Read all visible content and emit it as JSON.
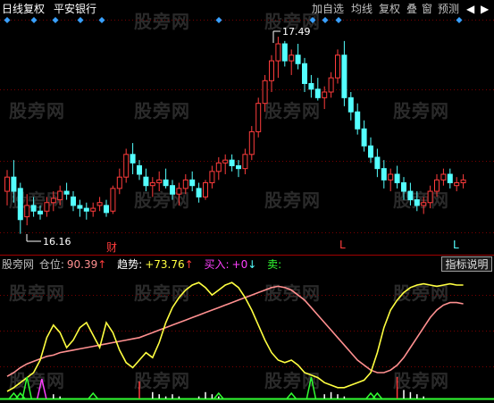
{
  "header": {
    "period": "日线",
    "adjust": "复权",
    "security_name": "平安银行"
  },
  "toolbar": [
    {
      "label": "加自选",
      "name": "add-watchlist-button"
    },
    {
      "label": "均线",
      "name": "moving-average-button"
    },
    {
      "label": "复权",
      "name": "adjust-button"
    },
    {
      "label": "叠",
      "name": "overlay-button"
    },
    {
      "label": "窗",
      "name": "window-button"
    },
    {
      "label": "预测",
      "name": "forecast-button"
    },
    {
      "label": "◀",
      "name": "scroll-left-button"
    },
    {
      "label": "▶",
      "name": "scroll-right-button"
    }
  ],
  "watermark": "股旁网",
  "annotations": {
    "high": "17.49",
    "low": "16.16",
    "cai": "财",
    "l1": "L",
    "l2": "L"
  },
  "indicator": {
    "name": "股旁网",
    "pos_label": "仓位:",
    "pos_value": "90.39",
    "trend_label": "趋势:",
    "trend_value": "+73.76",
    "buy_label": "买入:",
    "buy_value": "+0",
    "sell_label": "卖:",
    "explain_button": "指标说明"
  },
  "colors": {
    "up": "#ff3c3c",
    "down": "#54ffff",
    "pink_line": "#ff9090",
    "yellow_line": "#ffff40",
    "magenta": "#ff40ff",
    "green": "#32ff32",
    "blue_marker": "#39a0ff",
    "grid": "#7a0000"
  },
  "chart_data": [
    {
      "type": "candlestick",
      "series": [
        {
          "name": "平安银行"
        }
      ],
      "markers": {
        "high": 17.49,
        "low": 16.16
      },
      "candles": [
        [
          16.4,
          16.55,
          16.3,
          16.5
        ],
        [
          16.5,
          16.62,
          16.32,
          16.4
        ],
        [
          16.42,
          16.46,
          16.1,
          16.2
        ],
        [
          16.22,
          16.38,
          16.16,
          16.3
        ],
        [
          16.3,
          16.36,
          16.22,
          16.26
        ],
        [
          16.26,
          16.3,
          16.2,
          16.24
        ],
        [
          16.26,
          16.36,
          16.22,
          16.32
        ],
        [
          16.32,
          16.4,
          16.26,
          16.35
        ],
        [
          16.34,
          16.44,
          16.3,
          16.4
        ],
        [
          16.4,
          16.46,
          16.34,
          16.38
        ],
        [
          16.36,
          16.4,
          16.26,
          16.3
        ],
        [
          16.3,
          16.34,
          16.22,
          16.28
        ],
        [
          16.28,
          16.32,
          16.2,
          16.26
        ],
        [
          16.26,
          16.32,
          16.22,
          16.28
        ],
        [
          16.3,
          16.36,
          16.26,
          16.32
        ],
        [
          16.3,
          16.34,
          16.22,
          16.25
        ],
        [
          16.26,
          16.44,
          16.24,
          16.42
        ],
        [
          16.42,
          16.56,
          16.38,
          16.5
        ],
        [
          16.5,
          16.7,
          16.46,
          16.66
        ],
        [
          16.66,
          16.74,
          16.52,
          16.6
        ],
        [
          16.58,
          16.62,
          16.48,
          16.52
        ],
        [
          16.5,
          16.56,
          16.4,
          16.44
        ],
        [
          16.44,
          16.5,
          16.36,
          16.46
        ],
        [
          16.46,
          16.54,
          16.4,
          16.48
        ],
        [
          16.48,
          16.56,
          16.42,
          16.44
        ],
        [
          16.44,
          16.48,
          16.34,
          16.38
        ],
        [
          16.38,
          16.46,
          16.3,
          16.42
        ],
        [
          16.42,
          16.52,
          16.38,
          16.48
        ],
        [
          16.48,
          16.54,
          16.4,
          16.44
        ],
        [
          16.42,
          16.46,
          16.32,
          16.36
        ],
        [
          16.36,
          16.48,
          16.34,
          16.46
        ],
        [
          16.46,
          16.58,
          16.42,
          16.54
        ],
        [
          16.54,
          16.64,
          16.48,
          16.6
        ],
        [
          16.6,
          16.66,
          16.52,
          16.62
        ],
        [
          16.62,
          16.66,
          16.54,
          16.58
        ],
        [
          16.58,
          16.62,
          16.5,
          16.56
        ],
        [
          16.56,
          16.7,
          16.52,
          16.66
        ],
        [
          16.66,
          16.86,
          16.62,
          16.82
        ],
        [
          16.82,
          17.06,
          16.78,
          17.02
        ],
        [
          17.02,
          17.22,
          16.96,
          17.18
        ],
        [
          17.18,
          17.36,
          17.1,
          17.32
        ],
        [
          17.32,
          17.49,
          17.2,
          17.44
        ],
        [
          17.44,
          17.46,
          17.28,
          17.32
        ],
        [
          17.32,
          17.4,
          17.22,
          17.36
        ],
        [
          17.36,
          17.44,
          17.26,
          17.3
        ],
        [
          17.3,
          17.34,
          17.1,
          17.16
        ],
        [
          17.16,
          17.22,
          17.06,
          17.12
        ],
        [
          17.12,
          17.2,
          17.04,
          17.06
        ],
        [
          17.06,
          17.14,
          16.98,
          17.1
        ],
        [
          17.1,
          17.24,
          17.06,
          17.2
        ],
        [
          17.2,
          17.4,
          17.16,
          17.36
        ],
        [
          17.36,
          17.46,
          17.0,
          17.06
        ],
        [
          17.06,
          17.1,
          16.9,
          16.96
        ],
        [
          16.96,
          17.02,
          16.8,
          16.84
        ],
        [
          16.84,
          16.9,
          16.68,
          16.72
        ],
        [
          16.72,
          16.78,
          16.6,
          16.64
        ],
        [
          16.64,
          16.7,
          16.5,
          16.56
        ],
        [
          16.56,
          16.62,
          16.42,
          16.48
        ],
        [
          16.48,
          16.56,
          16.4,
          16.52
        ],
        [
          16.52,
          16.58,
          16.42,
          16.46
        ],
        [
          16.46,
          16.5,
          16.34,
          16.4
        ],
        [
          16.4,
          16.46,
          16.3,
          16.34
        ],
        [
          16.34,
          16.4,
          16.26,
          16.3
        ],
        [
          16.3,
          16.36,
          16.24,
          16.32
        ],
        [
          16.32,
          16.44,
          16.28,
          16.4
        ],
        [
          16.4,
          16.52,
          16.36,
          16.48
        ],
        [
          16.48,
          16.56,
          16.44,
          16.52
        ],
        [
          16.52,
          16.56,
          16.42,
          16.46
        ],
        [
          16.44,
          16.5,
          16.4,
          16.46
        ],
        [
          16.46,
          16.52,
          16.42,
          16.48
        ]
      ]
    },
    {
      "type": "line",
      "series": [
        {
          "name": "趋势",
          "values": [
            17,
            20,
            24,
            27,
            29,
            31,
            33,
            34,
            36,
            37,
            38,
            39,
            40,
            41,
            42,
            43,
            44,
            45,
            46,
            47,
            48,
            50,
            52,
            54,
            56,
            58,
            60,
            62,
            64,
            66,
            68,
            70,
            72,
            74,
            76,
            78,
            80,
            82,
            84,
            86,
            88,
            89,
            88,
            86,
            82,
            78,
            72,
            66,
            60,
            54,
            48,
            42,
            36,
            30,
            26,
            22,
            20,
            20,
            22,
            26,
            32,
            40,
            48,
            56,
            64,
            70,
            74,
            76,
            76,
            75
          ]
        },
        {
          "name": "仓位",
          "values": [
            5,
            8,
            12,
            16,
            20,
            30,
            48,
            58,
            52,
            40,
            46,
            56,
            60,
            50,
            40,
            60,
            52,
            38,
            28,
            24,
            30,
            36,
            32,
            44,
            60,
            72,
            80,
            86,
            90,
            92,
            88,
            82,
            86,
            90,
            92,
            88,
            80,
            70,
            58,
            46,
            36,
            30,
            28,
            30,
            26,
            20,
            18,
            16,
            12,
            10,
            8,
            8,
            10,
            12,
            14,
            20,
            36,
            56,
            70,
            78,
            84,
            88,
            90,
            91,
            90,
            89,
            90,
            91,
            90,
            90
          ]
        }
      ],
      "bars": [
        0,
        0,
        0,
        0,
        0,
        0,
        0,
        2,
        1,
        0,
        0,
        0,
        0,
        0,
        0,
        0,
        0,
        0,
        0,
        0,
        8,
        0,
        3,
        2,
        1,
        2,
        1,
        0,
        0,
        1,
        3,
        2,
        1,
        0,
        0,
        0,
        0,
        0,
        0,
        0,
        0,
        0,
        0,
        0,
        0,
        0,
        0,
        0,
        2,
        3,
        2,
        1,
        0,
        0,
        0,
        0,
        0,
        0,
        0,
        10,
        4,
        3,
        2,
        1,
        0,
        0,
        0,
        0,
        0,
        0
      ],
      "green_triangles": [
        1,
        2,
        3,
        13,
        32,
        43,
        46,
        55,
        56
      ],
      "magenta_triangles": [
        2
      ]
    }
  ]
}
